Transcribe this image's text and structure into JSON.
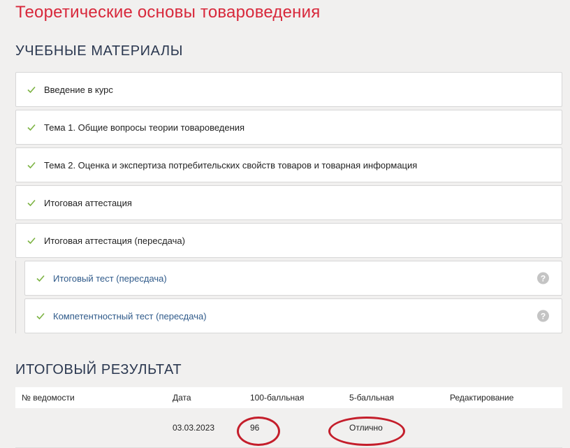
{
  "page_title": "Теоретические основы товароведения",
  "materials_heading": "УЧЕБНЫЕ МАТЕРИАЛЫ",
  "materials": [
    {
      "label": "Введение в курс"
    },
    {
      "label": "Тема 1. Общие вопросы теории товароведения"
    },
    {
      "label": "Тема 2. Оценка и экспертиза потребительских свойств товаров и товарная информация"
    },
    {
      "label": "Итоговая аттестация"
    },
    {
      "label": "Итоговая аттестация (пересдача)"
    }
  ],
  "sub_materials": [
    {
      "label": "Итоговый тест (пересдача)",
      "help": "?"
    },
    {
      "label": "Компетентностный тест (пересдача)",
      "help": "?"
    }
  ],
  "results_heading": "ИТОГОВЫЙ РЕЗУЛЬТАТ",
  "results_table": {
    "headers": [
      "№ ведомости",
      "Дата",
      "100-балльная",
      "5-балльная",
      "Редактирование"
    ],
    "rows": [
      [
        "",
        "03.03.2023",
        "96",
        "Отлично",
        ""
      ]
    ]
  },
  "colors": {
    "title": "#d8283b",
    "heading": "#2b3850",
    "check": "#7cb342",
    "link": "#2f5a8a",
    "highlight": "#c41e2b"
  },
  "icons": {
    "check": "check-icon",
    "help": "help-icon"
  }
}
